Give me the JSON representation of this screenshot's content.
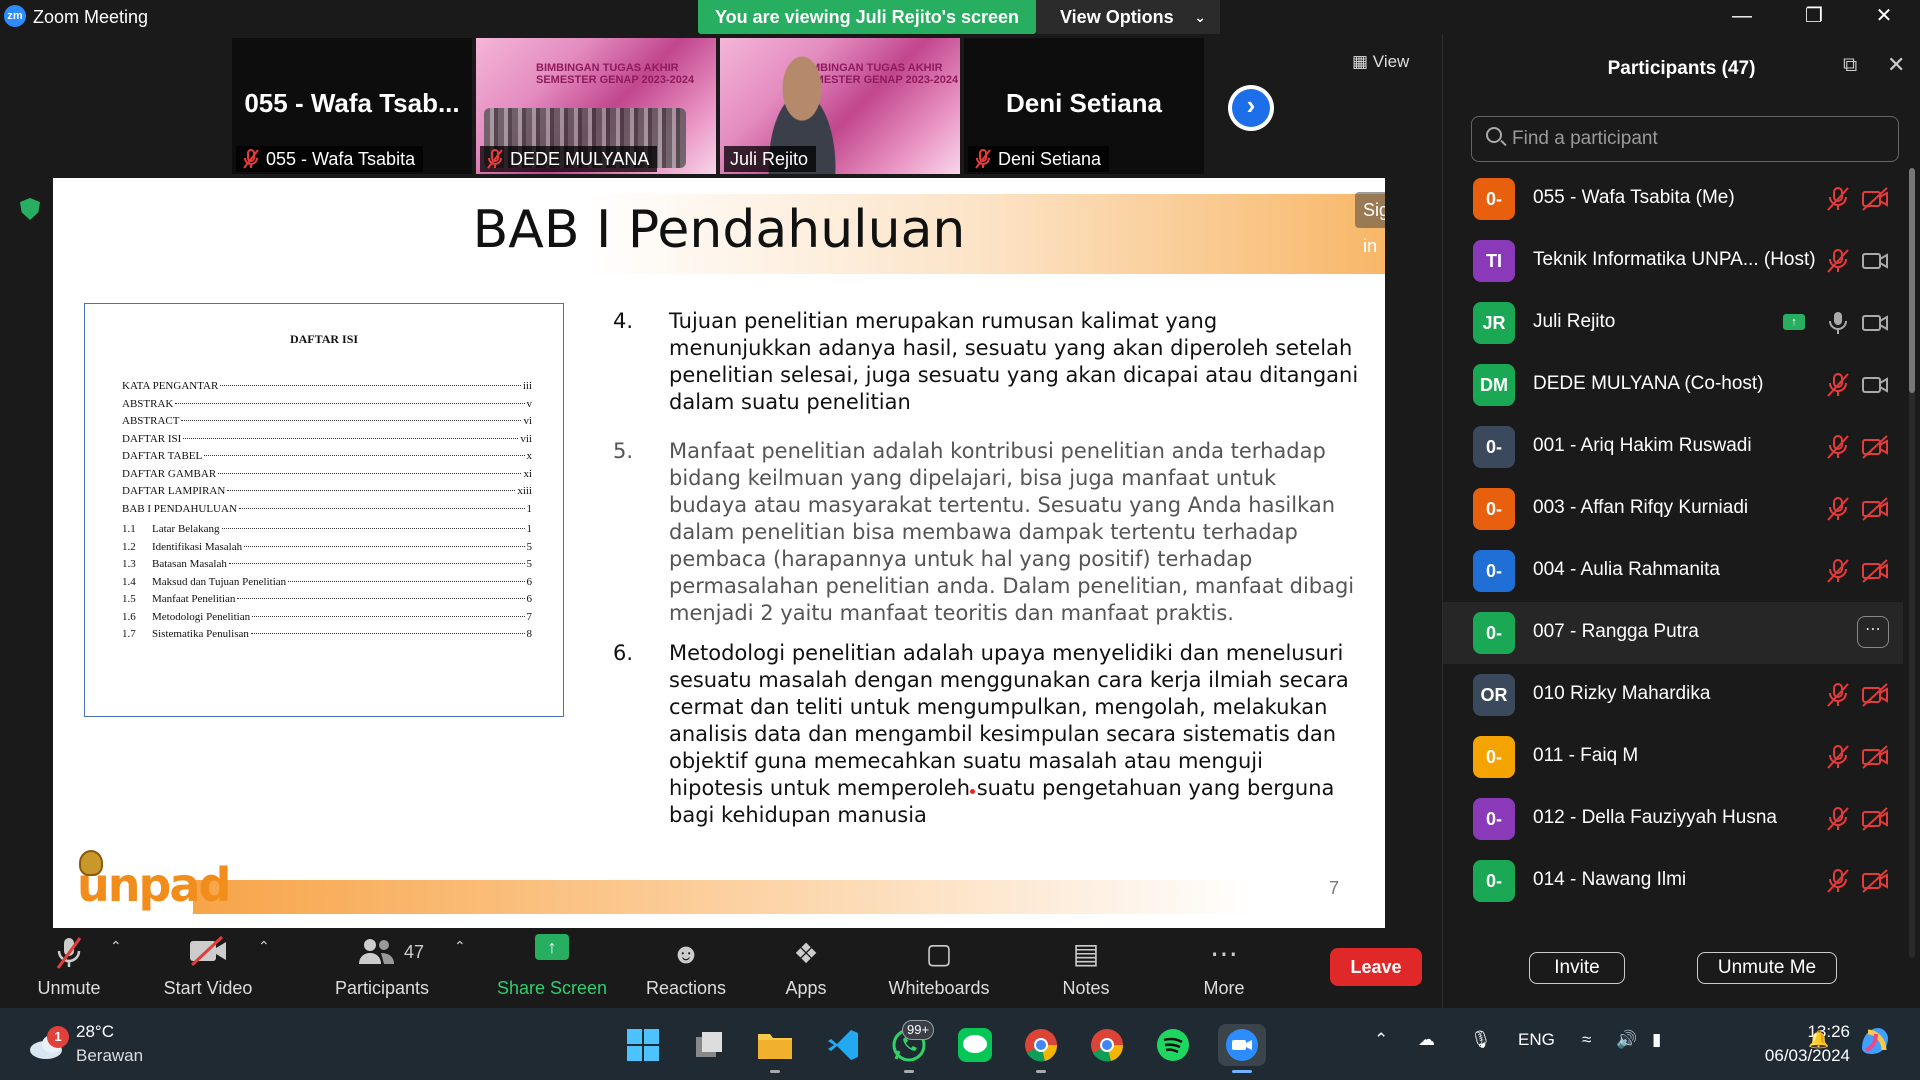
{
  "titlebar": {
    "logo": "zm",
    "title": "Zoom Meeting",
    "banner": "You are viewing Juli Rejito's screen",
    "view_options": "View Options"
  },
  "thumbnails": [
    {
      "big_name": "055  -  Wafa Tsab...",
      "label": "055 - Wafa Tsabita",
      "type": "name"
    },
    {
      "label": "DEDE MULYANA",
      "type": "slide"
    },
    {
      "label": "Juli Rejito",
      "type": "video"
    },
    {
      "big_name": "Deni Setiana",
      "label": "Deni Setiana",
      "type": "name"
    }
  ],
  "slide_thumb_text": {
    "line1": "BIMBINGAN TUGAS AKHIR",
    "line2": "SEMESTER GENAP 2023-2024"
  },
  "view_button": "View",
  "slide": {
    "title": "BAB I Pendahuluan",
    "sign_in": "Sign in",
    "page_number": "7",
    "logo_text": "unpad",
    "toc": {
      "heading": "DAFTAR ISI",
      "rows": [
        {
          "num": "",
          "label": "KATA PENGANTAR",
          "page": "iii"
        },
        {
          "num": "",
          "label": "ABSTRAK",
          "page": "v"
        },
        {
          "num": "",
          "label": "ABSTRACT",
          "page": "vi"
        },
        {
          "num": "",
          "label": "DAFTAR ISI",
          "page": "vii"
        },
        {
          "num": "",
          "label": "DAFTAR TABEL",
          "page": "x"
        },
        {
          "num": "",
          "label": "DAFTAR GAMBAR",
          "page": "xi"
        },
        {
          "num": "",
          "label": "DAFTAR LAMPIRAN",
          "page": "xiii"
        },
        {
          "num": "",
          "label": "BAB I PENDAHULUAN",
          "page": "1"
        },
        {
          "num": "1.1",
          "label": "Latar Belakang",
          "page": "1"
        },
        {
          "num": "1.2",
          "label": "Identifikasi Masalah",
          "page": "5"
        },
        {
          "num": "1.3",
          "label": "Batasan Masalah",
          "page": "5"
        },
        {
          "num": "1.4",
          "label": "Maksud dan Tujuan Penelitian",
          "page": "6"
        },
        {
          "num": "1.5",
          "label": "Manfaat Penelitian",
          "page": "6"
        },
        {
          "num": "1.6",
          "label": "Metodologi Penelitian",
          "page": "7"
        },
        {
          "num": "1.7",
          "label": "Sistematika Penulisan",
          "page": "8"
        }
      ]
    },
    "items": [
      {
        "n": "4.",
        "text": "Tujuan penelitian merupakan rumusan kalimat yang menunjukkan adanya hasil, sesuatu yang akan diperoleh setelah penelitian selesai, juga sesuatu yang akan dicapai atau ditangani dalam suatu penelitian"
      },
      {
        "n": "5.",
        "text": "Manfaat penelitian adalah kontribusi penelitian anda terhadap bidang keilmuan yang dipelajari, bisa juga manfaat untuk budaya atau masyarakat tertentu. Sesuatu yang Anda hasilkan dalam penelitian bisa membawa dampak tertentu terhadap pembaca (harapannya untuk hal yang positif) terhadap permasalahan penelitian anda. Dalam penelitian, manfaat dibagi menjadi 2 yaitu manfaat teoritis dan manfaat praktis."
      },
      {
        "n": "6.",
        "text": "Metodologi penelitian adalah upaya menyelidiki dan menelusuri sesuatu masalah dengan menggunakan cara kerja ilmiah secara cermat dan teliti untuk mengumpulkan, mengolah, melakukan analisis data dan mengambil kesimpulan secara sistematis dan objektif guna memecahkan suatu masalah atau menguji hipotesis untuk memperoleh suatu pengetahuan yang berguna bagi kehidupan manusia"
      }
    ]
  },
  "toolbar": {
    "unmute": "Unmute",
    "start_video": "Start Video",
    "participants": "Participants",
    "participants_count": "47",
    "share_screen": "Share Screen",
    "reactions": "Reactions",
    "apps": "Apps",
    "whiteboards": "Whiteboards",
    "notes": "Notes",
    "more": "More",
    "leave": "Leave"
  },
  "panel": {
    "title": "Participants (47)",
    "search_placeholder": "Find a participant",
    "invite": "Invite",
    "unmute_me": "Unmute Me",
    "participants": [
      {
        "initials": "0-",
        "name": "055 - Wafa Tsabita (Me)",
        "color": "#e8600e",
        "mic": "muted",
        "cam": "off"
      },
      {
        "initials": "TI",
        "name": "Teknik Informatika UNPA... (Host)",
        "color": "#8a3ab9",
        "mic": "muted",
        "cam": "on"
      },
      {
        "initials": "JR",
        "name": "Juli Rejito",
        "color": "#1aa855",
        "mic": "on",
        "cam": "on",
        "sharing": true
      },
      {
        "initials": "DM",
        "name": "DEDE MULYANA (Co-host)",
        "color": "#1aa855",
        "mic": "muted",
        "cam": "on"
      },
      {
        "initials": "0-",
        "name": "001 - Ariq Hakim Ruswadi",
        "color": "#3a4a5c",
        "mic": "muted",
        "cam": "off"
      },
      {
        "initials": "0-",
        "name": "003 - Affan Rifqy Kurniadi",
        "color": "#e8600e",
        "mic": "muted",
        "cam": "off"
      },
      {
        "initials": "0-",
        "name": "004 - Aulia Rahmanita",
        "color": "#1f6fd6",
        "mic": "muted",
        "cam": "off"
      },
      {
        "initials": "0-",
        "name": "007 - Rangga Putra",
        "color": "#1aa855",
        "mic": "none",
        "cam": "none",
        "hover": true
      },
      {
        "initials": "OR",
        "name": "010 Rizky Mahardika",
        "color": "#3a4a5c",
        "mic": "muted",
        "cam": "off"
      },
      {
        "initials": "0-",
        "name": "011 - Faiq M",
        "color": "#f5a300",
        "mic": "muted",
        "cam": "off"
      },
      {
        "initials": "0-",
        "name": "012 - Della Fauziyyah Husna",
        "color": "#8a3ab9",
        "mic": "muted",
        "cam": "off"
      },
      {
        "initials": "0-",
        "name": "014 - Nawang Ilmi",
        "color": "#1aa855",
        "mic": "muted",
        "cam": "off"
      }
    ]
  },
  "taskbar": {
    "weather_badge": "1",
    "temperature": "28°C",
    "weather_desc": "Berawan",
    "whatsapp_badge": "99+",
    "language": "ENG",
    "time": "13:26",
    "date": "06/03/2024"
  }
}
